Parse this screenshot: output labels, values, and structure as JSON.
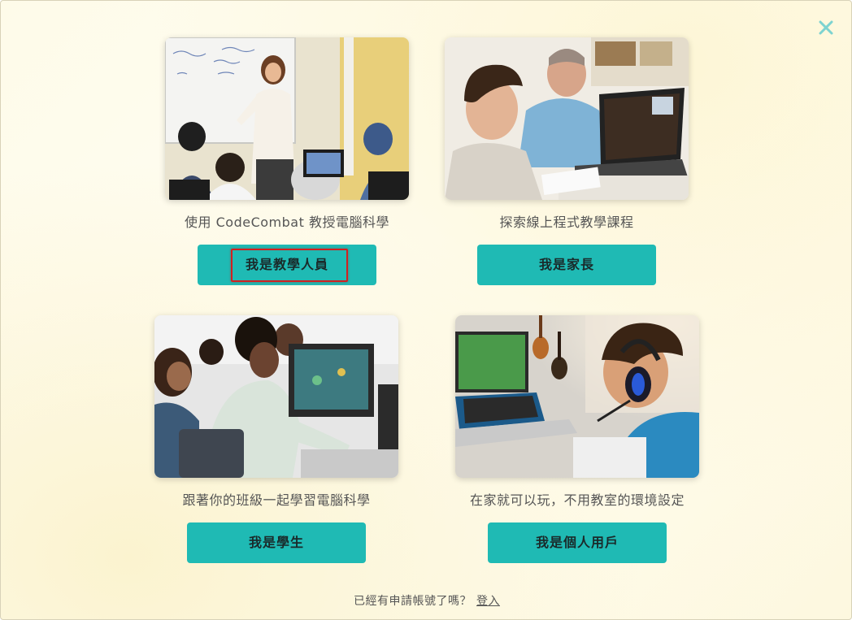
{
  "close_icon": "close-icon",
  "accent_color": "#1fbab4",
  "highlight_color": "#d22020",
  "cards": [
    {
      "caption": "使用 CodeCombat 教授電腦科學",
      "button_label": "我是教學人員",
      "highlighted": true
    },
    {
      "caption": "探索線上程式教學課程",
      "button_label": "我是家長",
      "highlighted": false
    },
    {
      "caption": "跟著你的班級一起學習電腦科學",
      "button_label": "我是學生",
      "highlighted": false
    },
    {
      "caption": "在家就可以玩，不用教室的環境設定",
      "button_label": "我是個人用戶",
      "highlighted": false
    }
  ],
  "footer": {
    "prompt": "已經有申請帳號了嗎？",
    "login_link": "登入"
  }
}
